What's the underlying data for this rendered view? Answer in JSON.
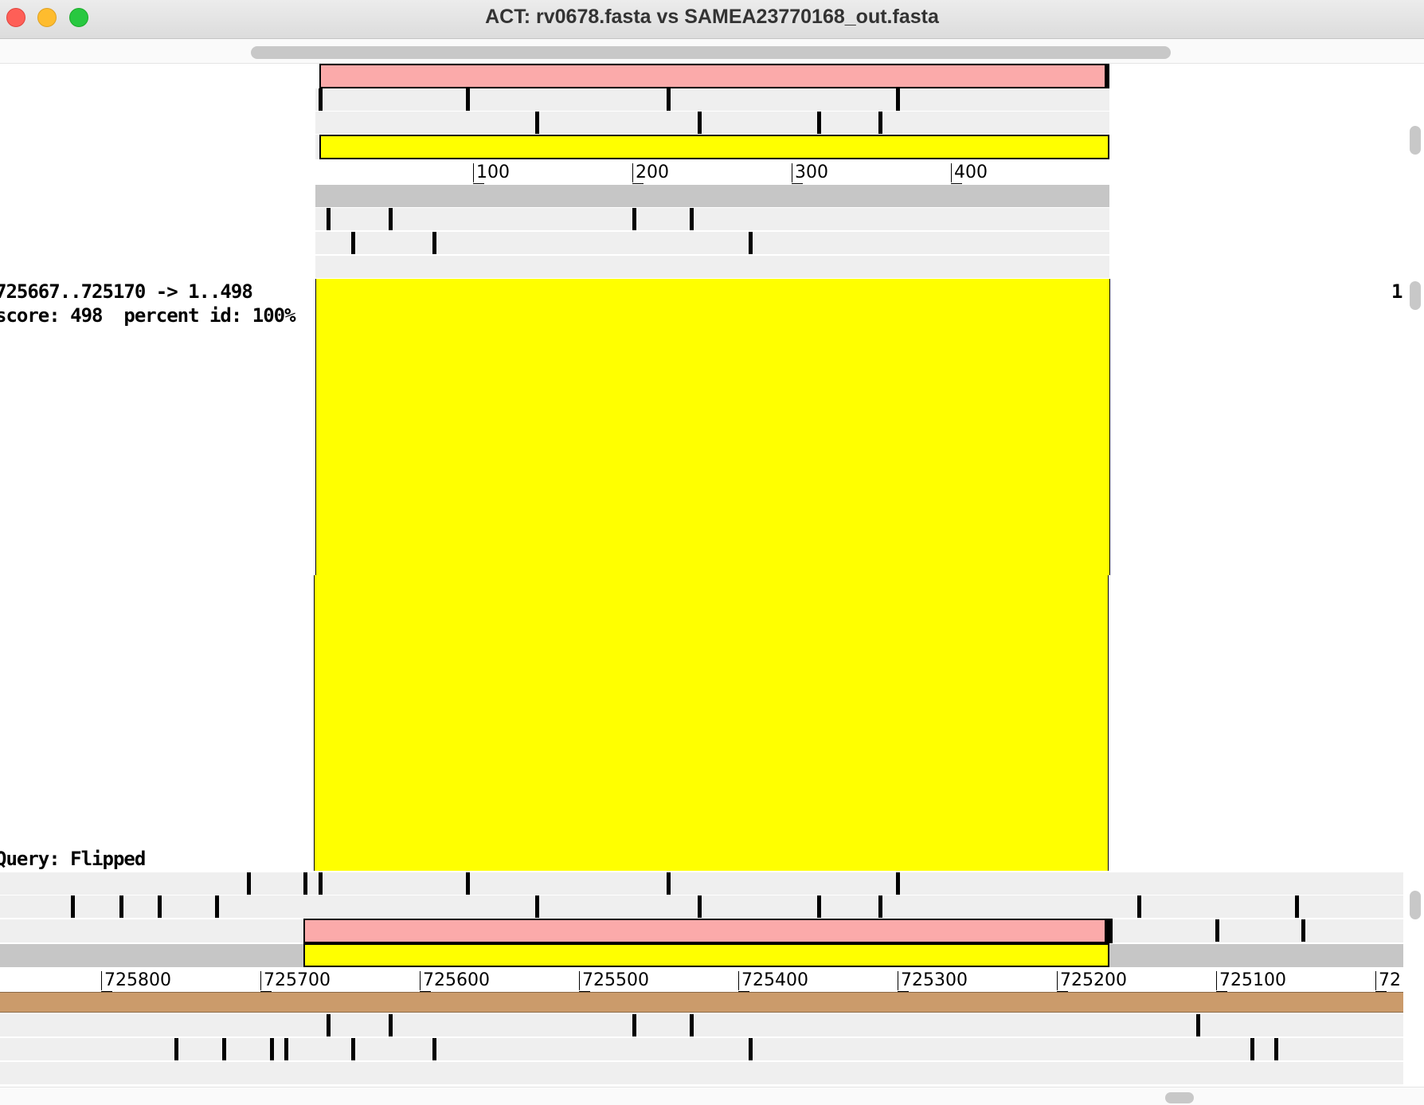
{
  "window": {
    "title": "ACT: rv0678.fasta vs SAMEA23770168_out.fasta"
  },
  "top_ruler": {
    "labels": [
      "100",
      "200",
      "300",
      "400"
    ]
  },
  "comparison": {
    "match_text": "725667..725170 -> 1..498",
    "score_text": "score: 498  percent id: 100%",
    "right_marker": "1",
    "query_status": "Query: Flipped",
    "match_color": "#ffff00"
  },
  "bottom_ruler": {
    "labels": [
      "725800",
      "725700",
      "725600",
      "725500",
      "725400",
      "725300",
      "725200",
      "725100",
      "72"
    ]
  },
  "colors": {
    "cds_feature": "#fbaaaa",
    "match_feature": "#ffff00",
    "sequence_bar": "#cb9b6b",
    "frame_track": "#efefef",
    "dna_track": "#c6c6c6"
  }
}
